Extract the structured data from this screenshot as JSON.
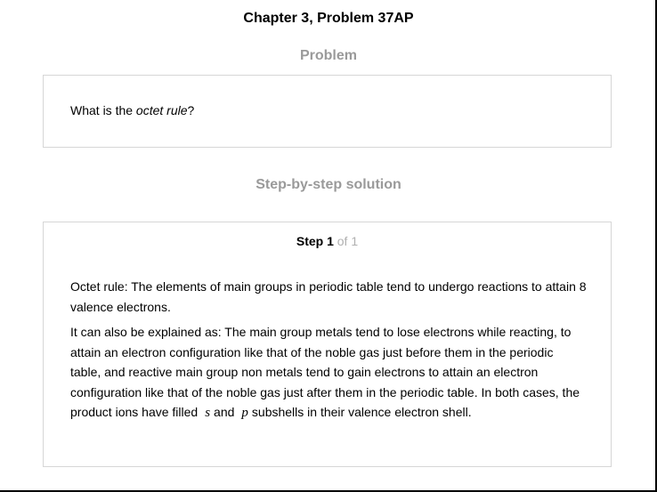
{
  "header": {
    "chapter_title": "Chapter 3, Problem 37AP"
  },
  "problem": {
    "heading": "Problem",
    "text_before": "What is the ",
    "text_emphasis": "octet rule",
    "text_after": "?"
  },
  "solution": {
    "heading": "Step-by-step solution",
    "step_word": "Step 1",
    "step_of": "of 1",
    "paragraph1": "Octet rule: The elements of main groups in periodic table tend to undergo reactions to attain 8 valence electrons.",
    "paragraph2_main": "It can also be explained as: The main group metals tend to lose electrons while reacting, to attain an electron configuration like that of the noble gas just before them in the periodic table, and reactive main group non metals tend to gain electrons to attain an electron configuration like that of the noble gas just after them in the periodic table. In both cases, the product ions have filled",
    "var_s": "s",
    "and_word": "and",
    "var_p": "p",
    "paragraph2_end": "subshells in their valence electron shell."
  }
}
